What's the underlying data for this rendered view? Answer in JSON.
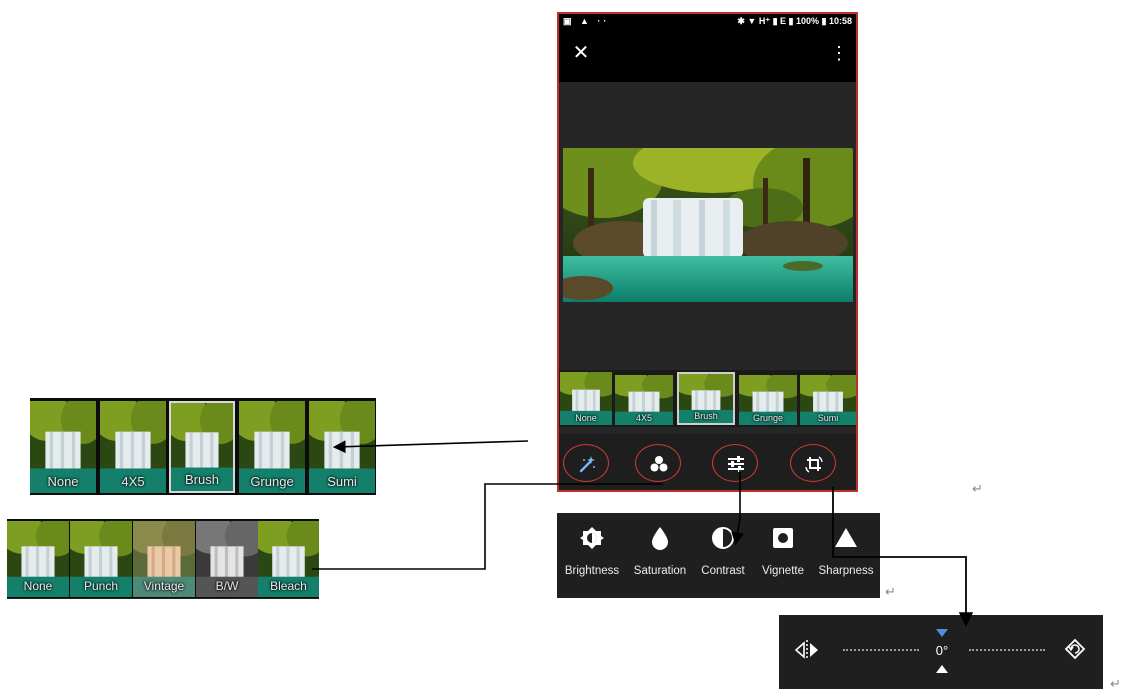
{
  "status_bar": {
    "left": "▣ ▲  ··",
    "right": "✱ ▼ H⁺ ▮ E ▮ 100% ▮ 10:58"
  },
  "filters_top": [
    "None",
    "4X5",
    "Brush",
    "Grunge",
    "Sumi"
  ],
  "filters_bottom": [
    "None",
    "Punch",
    "Vintage",
    "B/W",
    "Bleach"
  ],
  "adjustments": [
    "Brightness",
    "Saturation",
    "Contrast",
    "Vignette",
    "Sharpness"
  ],
  "rotation": {
    "angle": "0°"
  },
  "colors": {
    "accent": "#d23a32",
    "panel": "#1f1f1f",
    "rotation_marker": "#4a90e2"
  },
  "icons": [
    "close-icon",
    "more-vert-icon",
    "magic-wand-icon",
    "filters-icon",
    "tune-icon",
    "crop-rotate-icon",
    "brightness-icon",
    "drop-icon",
    "contrast-icon",
    "vignette-icon",
    "triangle-icon",
    "flip-icon",
    "rotate-icon"
  ]
}
